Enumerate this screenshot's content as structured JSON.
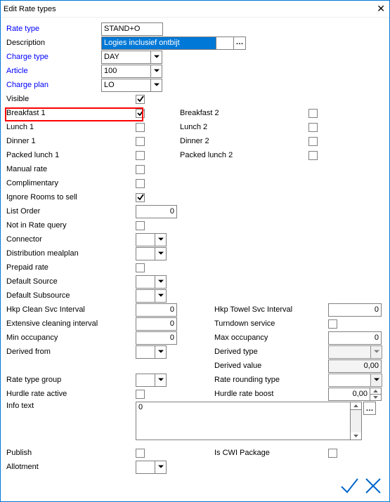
{
  "window": {
    "title": "Edit Rate types",
    "close_glyph": "✕"
  },
  "labels": {
    "rate_type": "Rate type",
    "description": "Description",
    "charge_type": "Charge type",
    "article": "Article",
    "charge_plan": "Charge plan",
    "visible": "Visible",
    "breakfast1": "Breakfast 1",
    "breakfast2": "Breakfast 2",
    "lunch1": "Lunch 1",
    "lunch2": "Lunch 2",
    "dinner1": "Dinner 1",
    "dinner2": "Dinner 2",
    "packed_lunch1": "Packed lunch 1",
    "packed_lunch2": "Packed lunch 2",
    "manual_rate": "Manual rate",
    "complimentary": "Complimentary",
    "ignore_rooms": "Ignore Rooms to sell",
    "list_order": "List Order",
    "not_in_rate_query": "Not in Rate query",
    "connector": "Connector",
    "dist_mealplan": "Distribution mealplan",
    "prepaid_rate": "Prepaid rate",
    "default_source": "Default Source",
    "default_subsource": "Default Subsource",
    "hkp_clean": "Hkp Clean Svc Interval",
    "hkp_towel": "Hkp Towel Svc Interval",
    "ext_clean": "Extensive cleaning interval",
    "turndown": "Turndown service",
    "min_occ": "Min occupancy",
    "max_occ": "Max occupancy",
    "derived_from": "Derived from",
    "derived_type": "Derived type",
    "derived_value": "Derived value",
    "rate_type_group": "Rate type group",
    "rate_rounding": "Rate rounding type",
    "hurdle_active": "Hurdle rate active",
    "hurdle_boost": "Hurdle rate boost",
    "info_text": "Info text",
    "publish": "Publish",
    "is_cwi": "Is CWI Package",
    "allotment": "Allotment"
  },
  "values": {
    "rate_type": "STAND+O",
    "description": "Logies inclusief ontbijt",
    "charge_type": "DAY",
    "article": "100",
    "charge_plan": "LO",
    "visible": true,
    "breakfast1": true,
    "breakfast2": false,
    "lunch1": false,
    "lunch2": false,
    "dinner1": false,
    "dinner2": false,
    "packed_lunch1": false,
    "packed_lunch2": false,
    "manual_rate": false,
    "complimentary": false,
    "ignore_rooms": true,
    "list_order": "0",
    "not_in_rate_query": false,
    "connector": "",
    "dist_mealplan": "",
    "prepaid_rate": false,
    "default_source": "",
    "default_subsource": "",
    "hkp_clean": "0",
    "hkp_towel": "0",
    "ext_clean": "0",
    "turndown": false,
    "min_occ": "0",
    "max_occ": "0",
    "derived_from": "",
    "derived_type": "",
    "derived_value": "0,00",
    "rate_type_group": "",
    "rate_rounding": "",
    "hurdle_active": false,
    "hurdle_boost": "0,00",
    "info_text": "0",
    "publish": false,
    "is_cwi": false,
    "allotment": ""
  },
  "glyphs": {
    "ellipsis": "…",
    "ok": "✓",
    "cancel": "✕"
  }
}
